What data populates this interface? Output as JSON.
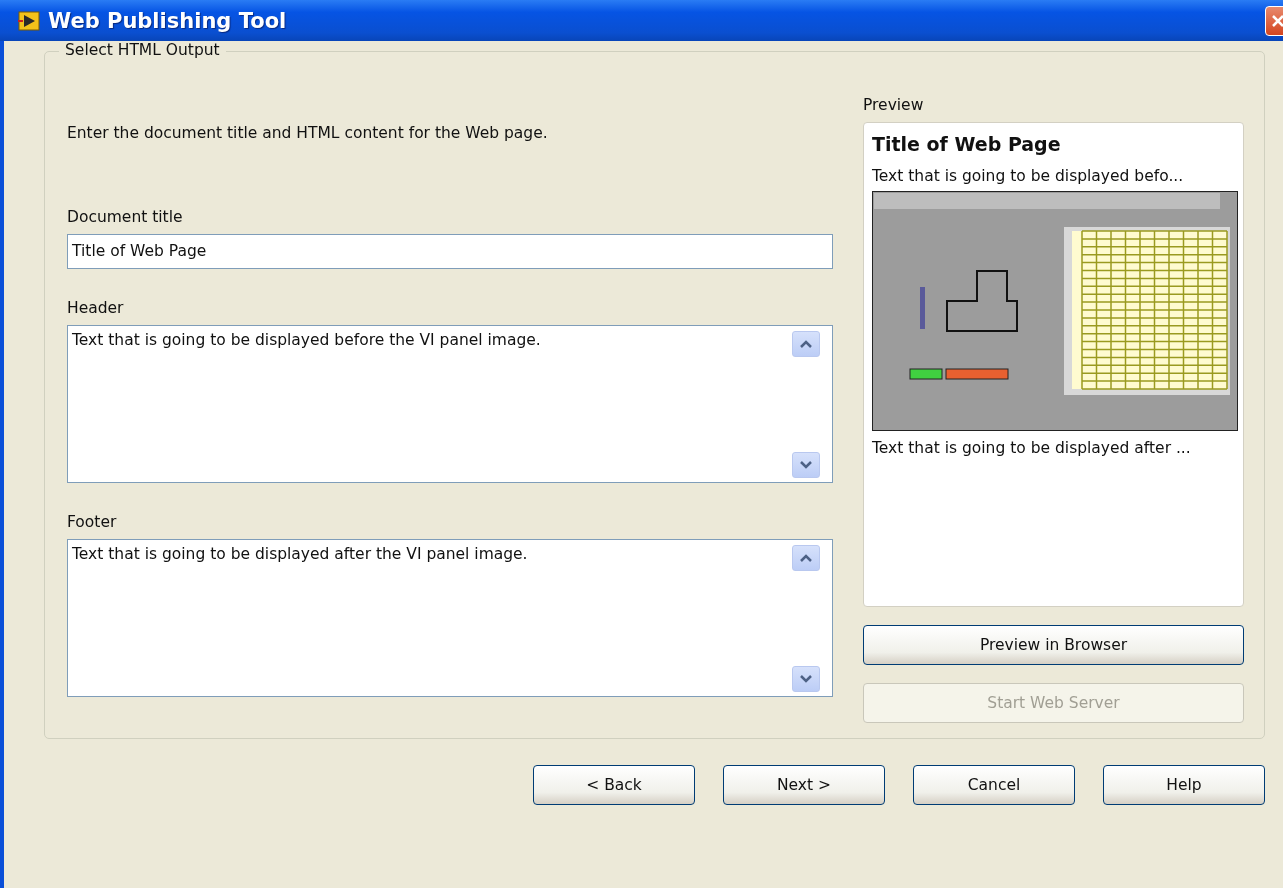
{
  "window": {
    "title": "Web Publishing Tool"
  },
  "group": {
    "legend": "Select HTML Output"
  },
  "instructions": "Enter the document title and HTML content for the Web page.",
  "fields": [
    {
      "kind": "line",
      "label": "Document title",
      "value": "Title of Web Page"
    },
    {
      "kind": "area",
      "label": "Header",
      "value": "Text that is going to be displayed before the VI panel image."
    },
    {
      "kind": "area",
      "label": "Footer",
      "value": "Text that is going to be displayed after the VI panel image."
    }
  ],
  "preview": {
    "label": "Preview",
    "title": "Title of Web Page",
    "header": "Text that is going to be displayed befo...",
    "footer": "Text that is going to be displayed after ..."
  },
  "side_buttons": [
    {
      "label": "Preview in Browser",
      "disabled": false
    },
    {
      "label": "Start Web Server",
      "disabled": true
    }
  ],
  "buttons": [
    {
      "label": "< Back",
      "disabled": false
    },
    {
      "label": "Next >",
      "disabled": false
    },
    {
      "label": "Cancel",
      "disabled": false
    },
    {
      "label": "Help",
      "disabled": false
    }
  ]
}
